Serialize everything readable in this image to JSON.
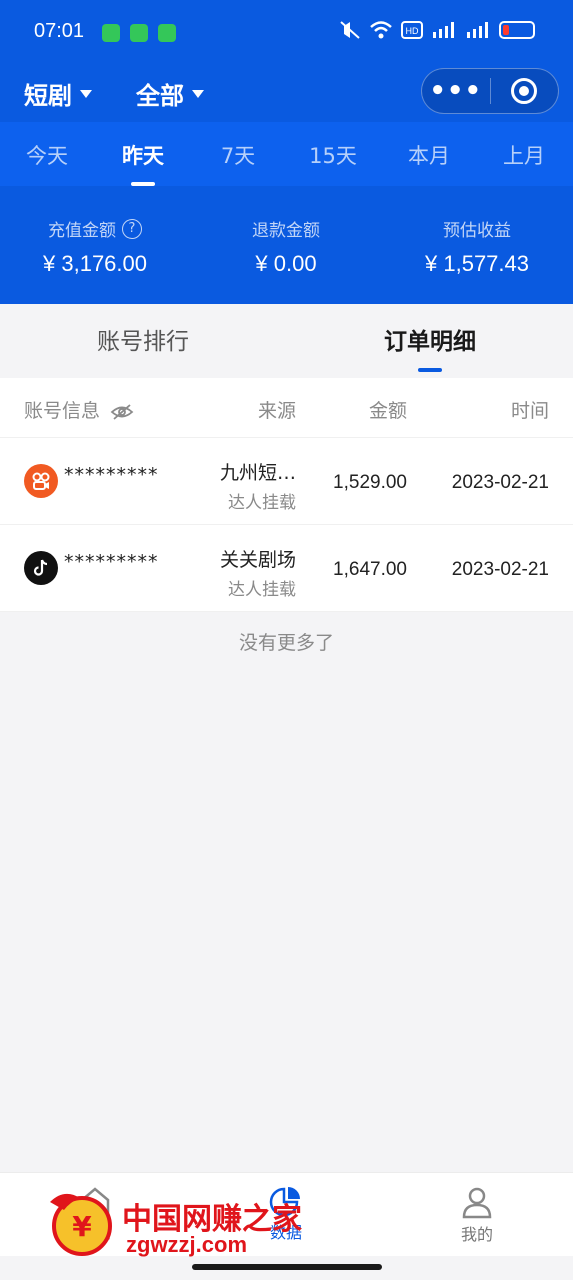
{
  "status_bar": {
    "time": "07:01"
  },
  "header": {
    "dropdown_left": "短剧",
    "dropdown_right": "全部"
  },
  "date_tabs": [
    "今天",
    "昨天",
    "7天",
    "15天",
    "本月",
    "上月"
  ],
  "date_tab_active": "昨天",
  "stats": [
    {
      "label": "充值金额",
      "value": "¥ 3,176.00"
    },
    {
      "label": "退款金额",
      "value": "¥ 0.00"
    },
    {
      "label": "预估收益",
      "value": "¥ 1,577.43"
    }
  ],
  "section_tabs": [
    "账号排行",
    "订单明细"
  ],
  "section_tab_active": "订单明细",
  "table": {
    "headers": {
      "account": "账号信息",
      "source": "来源",
      "amount": "金额",
      "time": "时间"
    },
    "rows": [
      {
        "account": "*********",
        "source": "九州短…",
        "source_sub": "达人挂载",
        "amount": "1,529.00",
        "time": "2023-02-21",
        "avatar_color": "#f15a22"
      },
      {
        "account": "*********",
        "source": "关关剧场",
        "source_sub": "达人挂载",
        "amount": "1,647.00",
        "time": "2023-02-21",
        "avatar_color": "#111111"
      }
    ]
  },
  "no_more": "没有更多了",
  "bottom_nav": [
    {
      "label": "首页",
      "icon": "home-icon"
    },
    {
      "label": "数据",
      "icon": "chart-icon"
    },
    {
      "label": "我的",
      "icon": "user-icon"
    }
  ],
  "watermark": {
    "cn": "中国网赚之家",
    "en": "zgwzzj.com"
  },
  "colors": {
    "primary": "#0a5ae0",
    "background": "#f4f4f6"
  }
}
